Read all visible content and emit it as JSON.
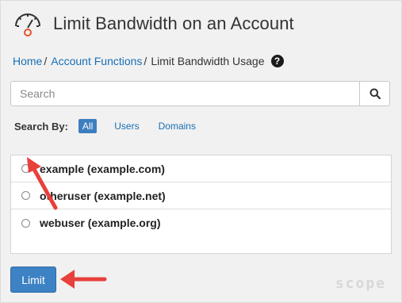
{
  "page": {
    "title": "Limit Bandwidth on an Account"
  },
  "breadcrumb": {
    "home": "Home",
    "sep1": "/",
    "functions": "Account Functions",
    "sep2": "/",
    "current": "Limit Bandwidth Usage",
    "help": "?"
  },
  "search": {
    "placeholder": "Search"
  },
  "search_by": {
    "label": "Search By:",
    "options": [
      "All",
      "Users",
      "Domains"
    ],
    "selected": "All"
  },
  "accounts": [
    {
      "label": "example (example.com)"
    },
    {
      "label": "otheruser (example.net)"
    },
    {
      "label": "webuser (example.org)"
    }
  ],
  "actions": {
    "limit_label": "Limit"
  },
  "watermark": "scope",
  "colors": {
    "accent": "#3d82c4",
    "link": "#1a6fb3",
    "annotation_arrow": "#e8403b",
    "gauge_accent": "#e8532a"
  },
  "icons": [
    "speedometer-icon",
    "help-icon",
    "search-icon"
  ]
}
